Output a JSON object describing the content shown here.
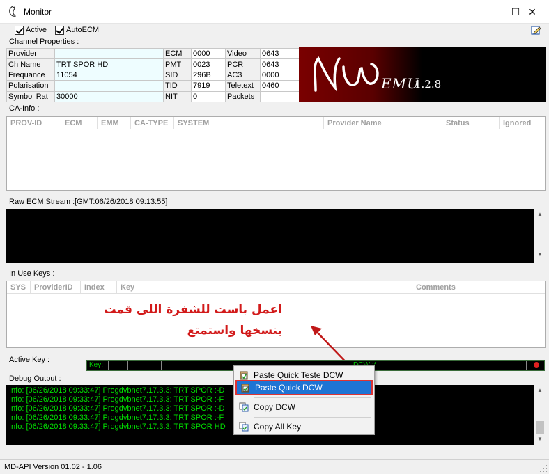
{
  "window": {
    "title": "Monitor",
    "minimize": "—",
    "maximize": "☐",
    "close": "✕"
  },
  "options": {
    "active_label": "Active",
    "autoecm_label": "AutoECM"
  },
  "channel": {
    "group_label": "Channel Properties :",
    "rows": [
      [
        "Provider",
        "",
        "ECM",
        "0000",
        "Video",
        "0643"
      ],
      [
        "Ch Name",
        "TRT SPOR HD",
        "PMT",
        "0023",
        "PCR",
        "0643"
      ],
      [
        "Frequance",
        "11054",
        "SID",
        "296B",
        "AC3",
        "0000"
      ],
      [
        "Polarisation",
        "",
        "TID",
        "7919",
        "Teletext",
        "0460"
      ],
      [
        "Symbol Rat",
        "30000",
        "NIT",
        "0",
        "Packets",
        ""
      ]
    ]
  },
  "logo": {
    "brand": "NWEMU",
    "version": "1.2.8"
  },
  "ca_info": {
    "group_label": "CA-Info :",
    "columns": [
      "PROV-ID",
      "ECM",
      "EMM",
      "CA-TYPE",
      "SYSTEM",
      "Provider Name",
      "Status",
      "Ignored"
    ]
  },
  "raw_ecm": {
    "group_label": "Raw ECM Stream :[GMT:06/26/2018 09:13:55]"
  },
  "in_use_keys": {
    "group_label": "In Use Keys :",
    "columns": [
      "SYS",
      "ProviderID",
      "Index",
      "Key",
      "Comments"
    ]
  },
  "annotation": {
    "line1": "اعمل باست للشفرة اللى قمت",
    "line2": "بنسخها واستمتع"
  },
  "active_key": {
    "group_label": "Active Key :",
    "key_label": "Key:",
    "dcw_label": "DCW :*"
  },
  "debug": {
    "group_label": "Debug Output :",
    "lines": [
      "Info:  [06/26/2018 09:33:47] Progdvbnet7.17.3.3: TRT SPOR  :-D",
      "Info:  [06/26/2018 09:33:47] Progdvbnet7.17.3.3: TRT SPOR  :-F",
      "Info:  [06/26/2018 09:33:47] Progdvbnet7.17.3.3: TRT SPOR  :-D",
      "Info:  [06/26/2018 09:33:47] Progdvbnet7.17.3.3: TRT SPOR  :-F",
      "Info:  [06/26/2018 09:33:47] Progdvbnet7.17.3.3: TRT SPOR HD"
    ]
  },
  "context_menu": {
    "items": [
      "Paste Quick Teste DCW",
      "Paste Quick DCW",
      "Copy DCW",
      "Copy All Key"
    ],
    "highlighted": "Paste Quick DCW"
  },
  "status": {
    "version": "MD-API Version 01.02 - 1.06"
  }
}
